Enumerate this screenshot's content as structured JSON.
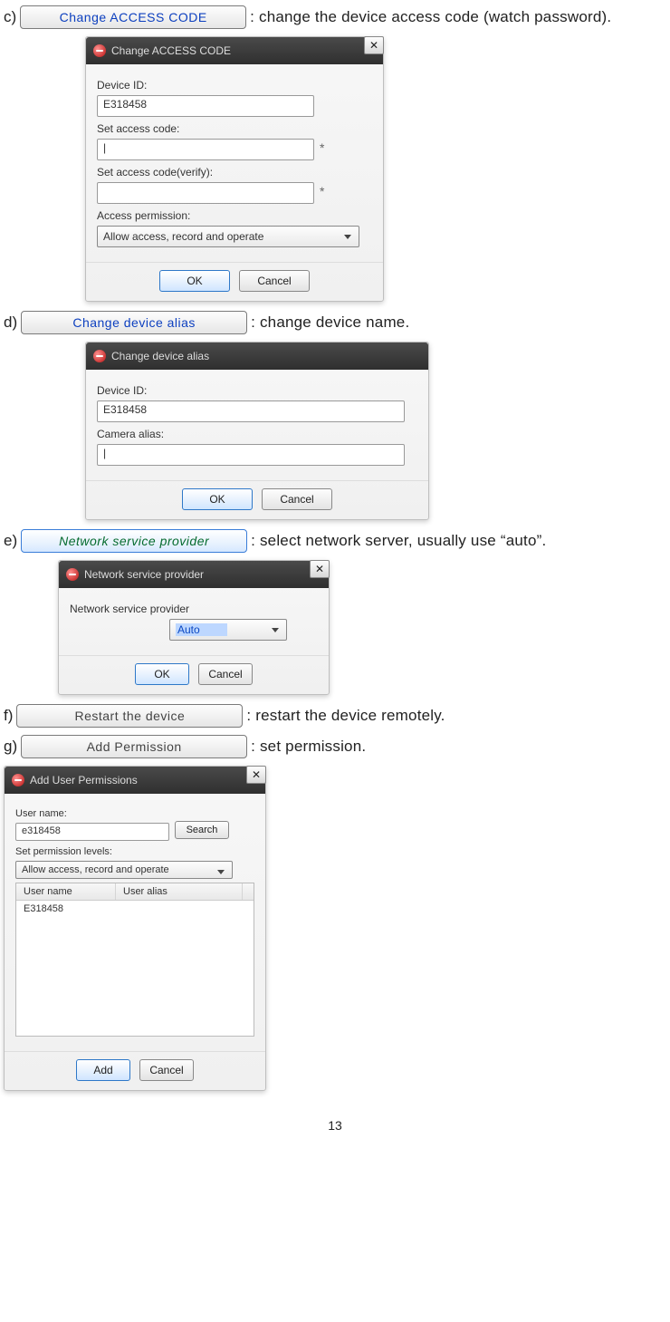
{
  "page_number": "13",
  "items": {
    "c": {
      "letter": "c)",
      "button": "Change ACCESS CODE",
      "desc": ": change the device access code (watch password).",
      "dialog": {
        "title": "Change ACCESS CODE",
        "device_id_label": "Device ID:",
        "device_id_value": "E318458",
        "set_code_label": "Set access code:",
        "set_code_value": "|",
        "verify_label": "Set access code(verify):",
        "verify_value": "",
        "perm_label": "Access permission:",
        "perm_value": "Allow access, record and operate",
        "ok": "OK",
        "cancel": "Cancel"
      }
    },
    "d": {
      "letter": "d)",
      "button": "Change device alias",
      "desc": ": change device name.",
      "dialog": {
        "title": "Change device alias",
        "device_id_label": "Device ID:",
        "device_id_value": "E318458",
        "alias_label": "Camera alias:",
        "alias_value": "|",
        "ok": "OK",
        "cancel": "Cancel"
      }
    },
    "e": {
      "letter": "e)",
      "button": "Network service provider",
      "desc": ": select network server, usually use “auto”.",
      "dialog": {
        "title": "Network service provider",
        "label": "Network service provider",
        "value": "Auto",
        "ok": "OK",
        "cancel": "Cancel"
      }
    },
    "f": {
      "letter": "f)",
      "button": "Restart the device",
      "desc": ": restart the device remotely."
    },
    "g": {
      "letter": "g)",
      "button": "Add Permission",
      "desc": ": set permission.",
      "dialog": {
        "title": "Add User Permissions",
        "uname_label": "User name:",
        "uname_value": "e318458",
        "search": "Search",
        "levels_label": "Set permission levels:",
        "levels_value": "Allow access, record and operate",
        "col_user": "User name",
        "col_alias": "User alias",
        "row_user": "E318458",
        "row_alias": "",
        "add": "Add",
        "cancel": "Cancel"
      }
    }
  }
}
